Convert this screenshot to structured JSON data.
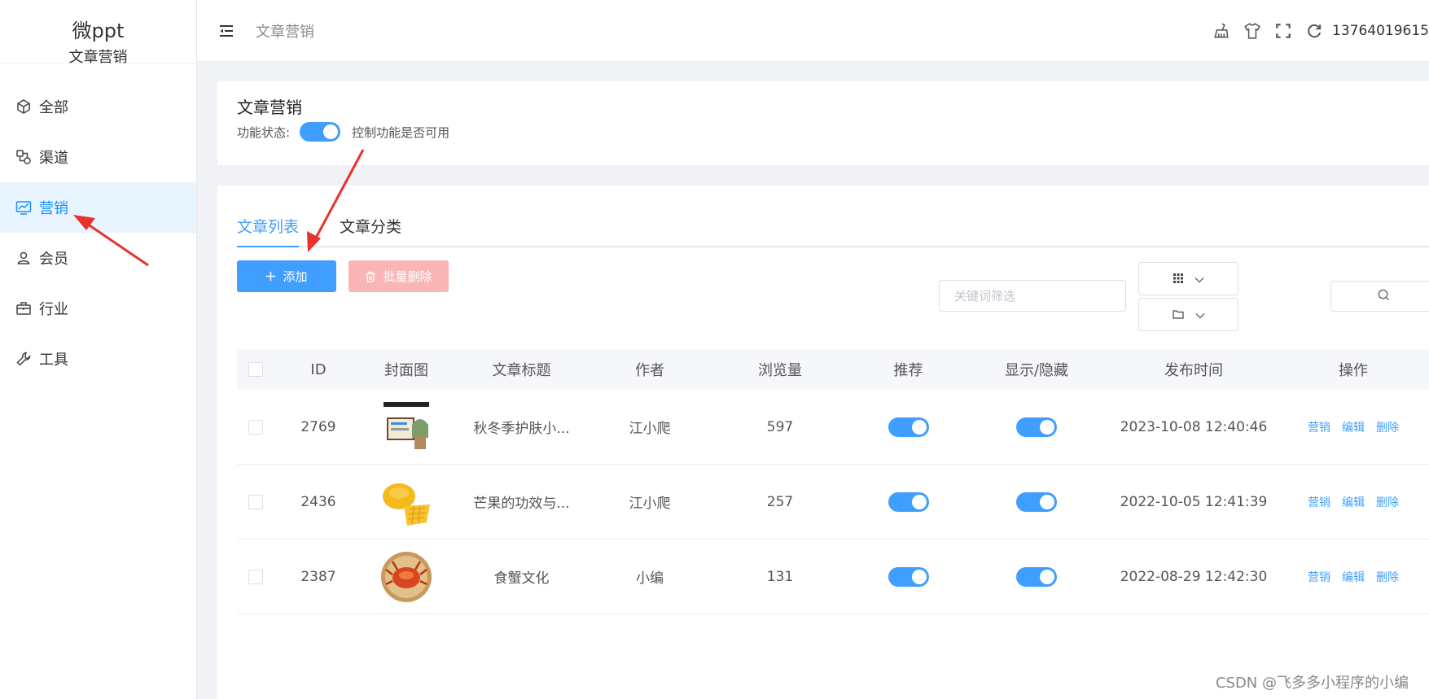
{
  "brand": {
    "title": "微ppt",
    "subtitle": "文章营销"
  },
  "sidebar": {
    "items": [
      {
        "label": "全部",
        "icon": "cube-icon",
        "active": false
      },
      {
        "label": "渠道",
        "icon": "channel-icon",
        "active": false
      },
      {
        "label": "营销",
        "icon": "chart-monitor-icon",
        "active": true
      },
      {
        "label": "会员",
        "icon": "user-icon",
        "active": false
      },
      {
        "label": "行业",
        "icon": "briefcase-icon",
        "active": false
      },
      {
        "label": "工具",
        "icon": "wrench-icon",
        "active": false
      }
    ]
  },
  "header": {
    "breadcrumb": "文章营销",
    "user": "13764019615",
    "icons": [
      "broom-icon",
      "shirt-icon",
      "fullscreen-icon",
      "refresh-icon"
    ]
  },
  "feature": {
    "title": "文章营销",
    "status_label": "功能状态:",
    "enabled": true,
    "hint": "控制功能是否可用"
  },
  "tabs": [
    {
      "label": "文章列表",
      "active": true
    },
    {
      "label": "文章分类",
      "active": false
    }
  ],
  "toolbar": {
    "add_label": "添加",
    "batch_delete_label": "批量删除",
    "keyword_placeholder": "关键词筛选"
  },
  "table": {
    "columns": [
      "ID",
      "封面图",
      "文章标题",
      "作者",
      "浏览量",
      "推荐",
      "显示/隐藏",
      "发布时间",
      "操作"
    ],
    "rows": [
      {
        "id": "2769",
        "title": "秋冬季护肤小...",
        "author": "江小爬",
        "views": "597",
        "recommend": true,
        "visible": true,
        "time": "2023-10-08 12:40:46"
      },
      {
        "id": "2436",
        "title": "芒果的功效与...",
        "author": "江小爬",
        "views": "257",
        "recommend": true,
        "visible": true,
        "time": "2022-10-05 12:41:39"
      },
      {
        "id": "2387",
        "title": "食蟹文化",
        "author": "小编",
        "views": "131",
        "recommend": true,
        "visible": true,
        "time": "2022-08-29 12:42:30"
      }
    ],
    "actions": [
      "营销",
      "编辑",
      "删除"
    ]
  },
  "watermark": "CSDN @飞多多小程序的小编",
  "colors": {
    "primary": "#409eff",
    "danger_light": "#fab6b6",
    "arrow": "#e8322d",
    "active_bg": "#e8f4ff"
  }
}
